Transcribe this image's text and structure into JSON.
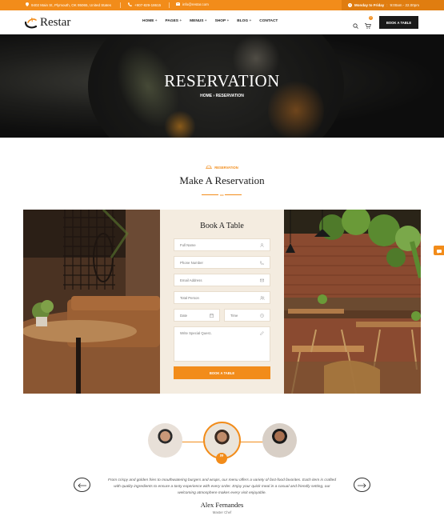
{
  "topbar": {
    "address": "9402 Main St, Plymouth, OK 95065, United States",
    "phone": "+907-829-18615",
    "email": "info@restar.com",
    "hours_days": "Monday to Friday",
    "hours_time": "9:00am - 22.00pm"
  },
  "header": {
    "logo_text": "Restar",
    "nav": [
      "HOME",
      "PAGES",
      "MENUS",
      "SHOP",
      "BLOG",
      "CONTACT"
    ],
    "cart_count": "0",
    "book_button": "BOOK A TABLE"
  },
  "hero": {
    "title": "RESERVATION",
    "breadcrumb_home": "HOME",
    "breadcrumb_current": "RESERVATION"
  },
  "section": {
    "eyebrow": "RESERVATION",
    "title": "Make A Reservation"
  },
  "form": {
    "title": "Book A Table",
    "full_name": "Full Name",
    "phone": "Phone Number",
    "email": "Email Address",
    "persons": "Total Person",
    "date": "Date",
    "time": "Time",
    "request": "Write Special Quest..",
    "submit": "BOOK A TABLE"
  },
  "testimonial": {
    "quote": "From crispy and golden fries to mouthwatering burgers and wraps, our menu offers a variety of fast-food favorites. Each item is crafted with quality ingredients to ensure a tasty experience with every order. Enjoy your quick meal in a casual and friendly setting, our welcoming atmosphere makes every visit enjoyable.",
    "name": "Alex Fernandes",
    "role": "Master Chef"
  },
  "colors": {
    "accent": "#f28c1a",
    "dark": "#1a1a1a",
    "form_bg": "#f4ece0"
  }
}
